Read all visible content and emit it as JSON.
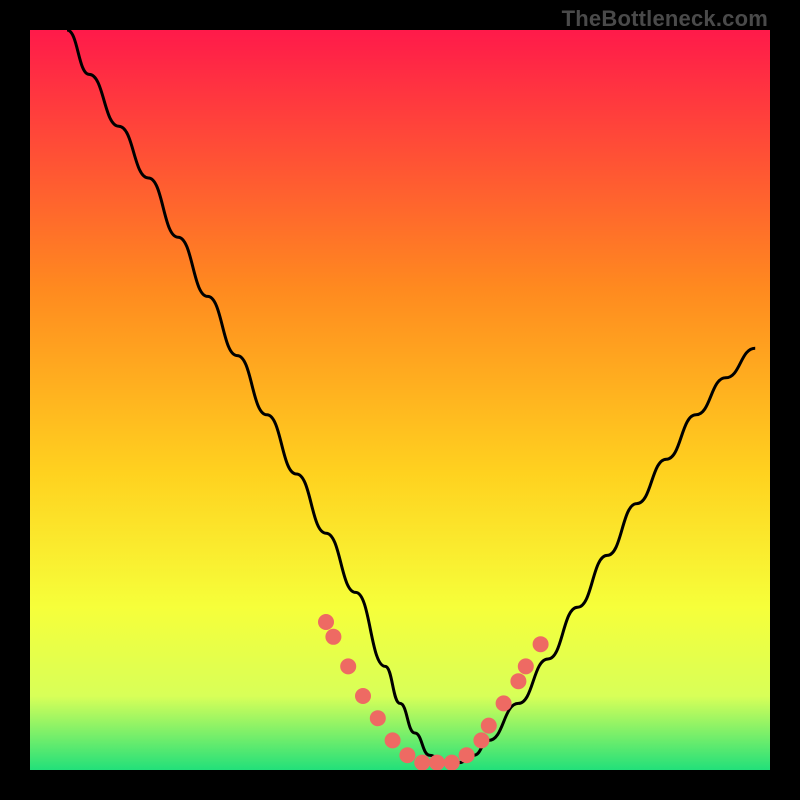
{
  "watermark": "TheBottleneck.com",
  "colors": {
    "gradient_top": "#ff1a4a",
    "gradient_mid1": "#ff6a2a",
    "gradient_mid2": "#ffd21f",
    "gradient_mid3": "#f6ff3a",
    "gradient_bottom": "#22e07a",
    "curve": "#000000",
    "dots": "#ee6a63",
    "frame": "#000000"
  },
  "chart_data": {
    "type": "line",
    "title": "",
    "xlabel": "",
    "ylabel": "",
    "xlim": [
      0,
      100
    ],
    "ylim": [
      0,
      100
    ],
    "grid": false,
    "series": [
      {
        "name": "bottleneck-curve",
        "x": [
          5,
          8,
          12,
          16,
          20,
          24,
          28,
          32,
          36,
          40,
          44,
          48,
          50,
          52,
          54,
          56,
          58,
          60,
          62,
          66,
          70,
          74,
          78,
          82,
          86,
          90,
          94,
          98
        ],
        "y": [
          100,
          94,
          87,
          80,
          72,
          64,
          56,
          48,
          40,
          32,
          24,
          14,
          9,
          5,
          2,
          1,
          1,
          2,
          4,
          9,
          15,
          22,
          29,
          36,
          42,
          48,
          53,
          57
        ]
      }
    ],
    "highlight_points": {
      "name": "highlight-dots",
      "x": [
        40,
        41,
        43,
        45,
        47,
        49,
        51,
        53,
        55,
        57,
        59,
        61,
        62,
        64,
        66,
        67,
        69
      ],
      "y": [
        20,
        18,
        14,
        10,
        7,
        4,
        2,
        1,
        1,
        1,
        2,
        4,
        6,
        9,
        12,
        14,
        17
      ]
    },
    "gradient_stops": [
      {
        "offset": 0,
        "color": "#ff1a4a"
      },
      {
        "offset": 35,
        "color": "#ff8a1f"
      },
      {
        "offset": 60,
        "color": "#ffd21f"
      },
      {
        "offset": 78,
        "color": "#f6ff3a"
      },
      {
        "offset": 90,
        "color": "#d8ff58"
      },
      {
        "offset": 100,
        "color": "#22e07a"
      }
    ]
  }
}
